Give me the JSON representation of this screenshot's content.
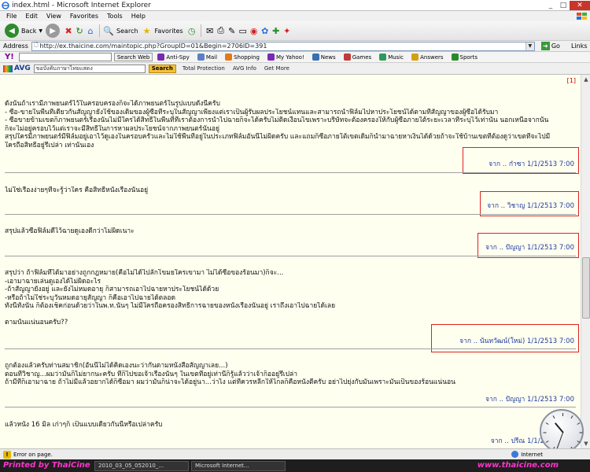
{
  "window": {
    "title": "index.html - Microsoft Internet Explorer"
  },
  "menu": [
    "File",
    "Edit",
    "View",
    "Favorites",
    "Tools",
    "Help"
  ],
  "toolbar": {
    "back_label": "Back",
    "search_label": "Search",
    "favorites_label": "Favorites"
  },
  "address": {
    "label": "Address",
    "url": "http://ex.thaicine.com/maintopic.php?GroupID=01&Begin=2706ID=391",
    "go_label": "Go",
    "links_label": "Links"
  },
  "yahoo": {
    "search_web": "Search Web",
    "items": [
      "Anti-Spy",
      "Mail",
      "Shopping",
      "My Yahoo!",
      "News",
      "Games",
      "Music",
      "Answers",
      "Sports"
    ]
  },
  "avg": {
    "logo": "AVG",
    "search_value": "ขอบังคับภาษาไทยแสดง",
    "search_button": "Search",
    "items": [
      "Total Protection",
      "AVG Info",
      "Get More"
    ]
  },
  "content": {
    "marker": "[1]",
    "posts": [
      {
        "lines": [
          "ดังนั้นถ้าเรามีภาพยนตร์ไว้ในครอบครองก็จะได้ภาพยนตร์ในรูปแบบดังนี้ครับ",
          "- ซื้อ-ขายในพื้นที่เดียวกันสัญญายังใช้ของเดิมของผู้ซื้อที่ระบุในสัญญาเพียงแต่เราเป็นผู้รับผลประโยชน์แทนและสามารถนำฟิล์มไปหาประโยชน์ได้ตามที่สัญญาของผู้ซื้อได้รับมา",
          "- ซื้อขายข้ามเขตก็ภาพยนตร์เรื่องนั้นไม่มีใครได้สิทธิ์ในพื้นที่ที่เราต้องการนำไปฉายก็จะได้ครับไม่ติดเงื่อนไขเพราะบริษัทจะต้องครองให้กับผู้ซื้อภายใต้ระยะเวลาที่ระบุไว้เท่านั้น นอกเหนือจากนั้น",
          "ก็จะไม่อยู่ครอบไว้แต่เราจะมีสิทธิ์ในการหาผลประโยชน์จากภาพยนตร์นั้นอยู่",
          "สรุปใครมีภาพยนตร์มีฟิล์มอยู่เอาไว้ดูเองในครอบครัวและไม่ใช้พื้นที่อยู่ในประเภทฟิล์มอันนี้ไม่ผิดครับ และแถมก็ซื้อภายใต้เขตเดิมก็นำมาฉายหาเงินได้ด้วยถ้าจะใช้บ้านเขตที่ต้องดูว่าเขตที่จะไปมี",
          "ใครถือสิทธิ์อยู่รึเปล่า เท่านั้นเอง"
        ],
        "signature": "จาก .. ก๋าซา 1/1/2513 7:00"
      },
      {
        "lines": [
          "ไม่ใช่เรื่องง่ายๆที่จะรู้ว่าใคร คือสิทธิ์หนังเรื่องนั้นอยู่"
        ],
        "signature": "จาก .. วิชาญ 1/1/2513 7:00"
      },
      {
        "lines": [
          "สรุปแล้วซื้อฟิล์มดีไว้ฉายดูเองดีกว่าไม่ผิดเนาะ"
        ],
        "signature": "จาก .. ปัญญา 1/1/2513 7:00"
      },
      {
        "lines": [
          "สรุปว่า ถ้าฟิล์มที่ได้มาอย่างถูกกฎหมาย(คือไม่ได้ไปลักโขมยใครเขามา ไม่ได้ซื้อของร้อนมา)ก็จะ...",
          "-เอามาฉายเล่นดูเองได้ไม่ผิดอะไร",
          "-ถ้าสัญญายังอยู่ และยังไม่หมดอายุ ก็สามารถเอาไปฉายหาประโยชน์ได้ด้วย",
          "-หรือถ้าไม่ใช่ระบุวันหมดอายุสัญญา ก็คือเอาไปฉายได้ตลอด",
          "ทั้งนี้ทั้งนั้น ก็ต้องเช็คก่อนด้วยว่าในพ.ท.นั้นๆ ไม่มีใครถือครองสิทธิ์การฉายของหนังเรื่องนั้นอยู่ เราถึงเอาไปฉายได้เลย",
          "",
          "ตามนั้นแน่นอนครับ??"
        ],
        "signature": "จาก .. นันทวัฒน์(ใหม่) 1/1/2513 7:00"
      },
      {
        "lines": [
          "ถูกต้องแล้วครับท่านสมาชิก(อันนี้ไม่ได้คิดเองนะว่ากันตามหนังสือสัญญาเลย...)",
          "ตอนที่วิชาญ...ผมว่ามันก็ไม่ยากนะครับ ที่ก็ไปขอเจ้าเรื่องนั้นๆ ในเขตที่อยู่เท่านี้ก็รู้แล้วว่าเจ้าก็ออยู่รึเปล่า",
          "ถ้ามีที่ก็เอามาฉาย ถ้าไม่มีแล้วอยากได้ก็ซื้อมา ผมว่ามันก็น่าจะได้อยู่นา...ว่าไง แต่ที่ควรหลีกให้ไกลก็คือหนังตีครับ อย่าไปยุ่งกับมันเพราะมันเป็นของร้อนแน่นอน"
        ],
        "signature": "จาก .. ปัญญา 1/1/2513 7:00"
      },
      {
        "lines": [
          "แล้วหนัง 16 มิล เก่าๆก็ เป็นแบบเดียวกันนี้หรือเปล่าครับ"
        ],
        "signature": "จาก .. ปรีณ 1/1/2513 7:00"
      }
    ]
  },
  "status": {
    "text": "Error on page.",
    "zone": "Internet"
  },
  "taskbar": {
    "watermark_left": "Printed by ThaiCine",
    "watermark_right": "www.thaicine.com",
    "items": [
      "2010_03_05_052010_...",
      "Microsoft Internet..."
    ]
  }
}
